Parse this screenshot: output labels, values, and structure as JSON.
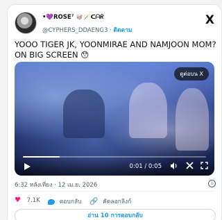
{
  "author": {
    "display_name": "•💜ROSE⁷ 🥡🪄ᑕᗩᖇ",
    "handle": "@CYPHERS_DDAENG3",
    "separator": "·",
    "follow_label": "ติดตาม"
  },
  "brand": {
    "logo_glyph": "X"
  },
  "tweet": {
    "text": "YOOO TIGER JK, YOONMIRAE AND NAMJOON MOM? ON BIG SCREEN 😯"
  },
  "video": {
    "overlay_pill": "ดูต่อบน X",
    "time": "0:01 / 0:05",
    "progress": 0.2,
    "icons": [
      "play-icon",
      "volume-icon",
      "x-icon",
      "fullscreen-icon"
    ]
  },
  "meta": {
    "timestamp": "6:32 หลังเที่ยง · 12 เม.ย. 2026",
    "info_glyph": "i"
  },
  "actions": {
    "likes": "7.1K",
    "reply_label": "ตอบกลับ",
    "copy_link_label": "คัดลอกลิงก์"
  },
  "replies_button": {
    "label": "อ่าน 10 การตอบกลับ"
  },
  "colors": {
    "accent": "#1d9bf0",
    "like": "#f91880",
    "muted": "#536471"
  }
}
